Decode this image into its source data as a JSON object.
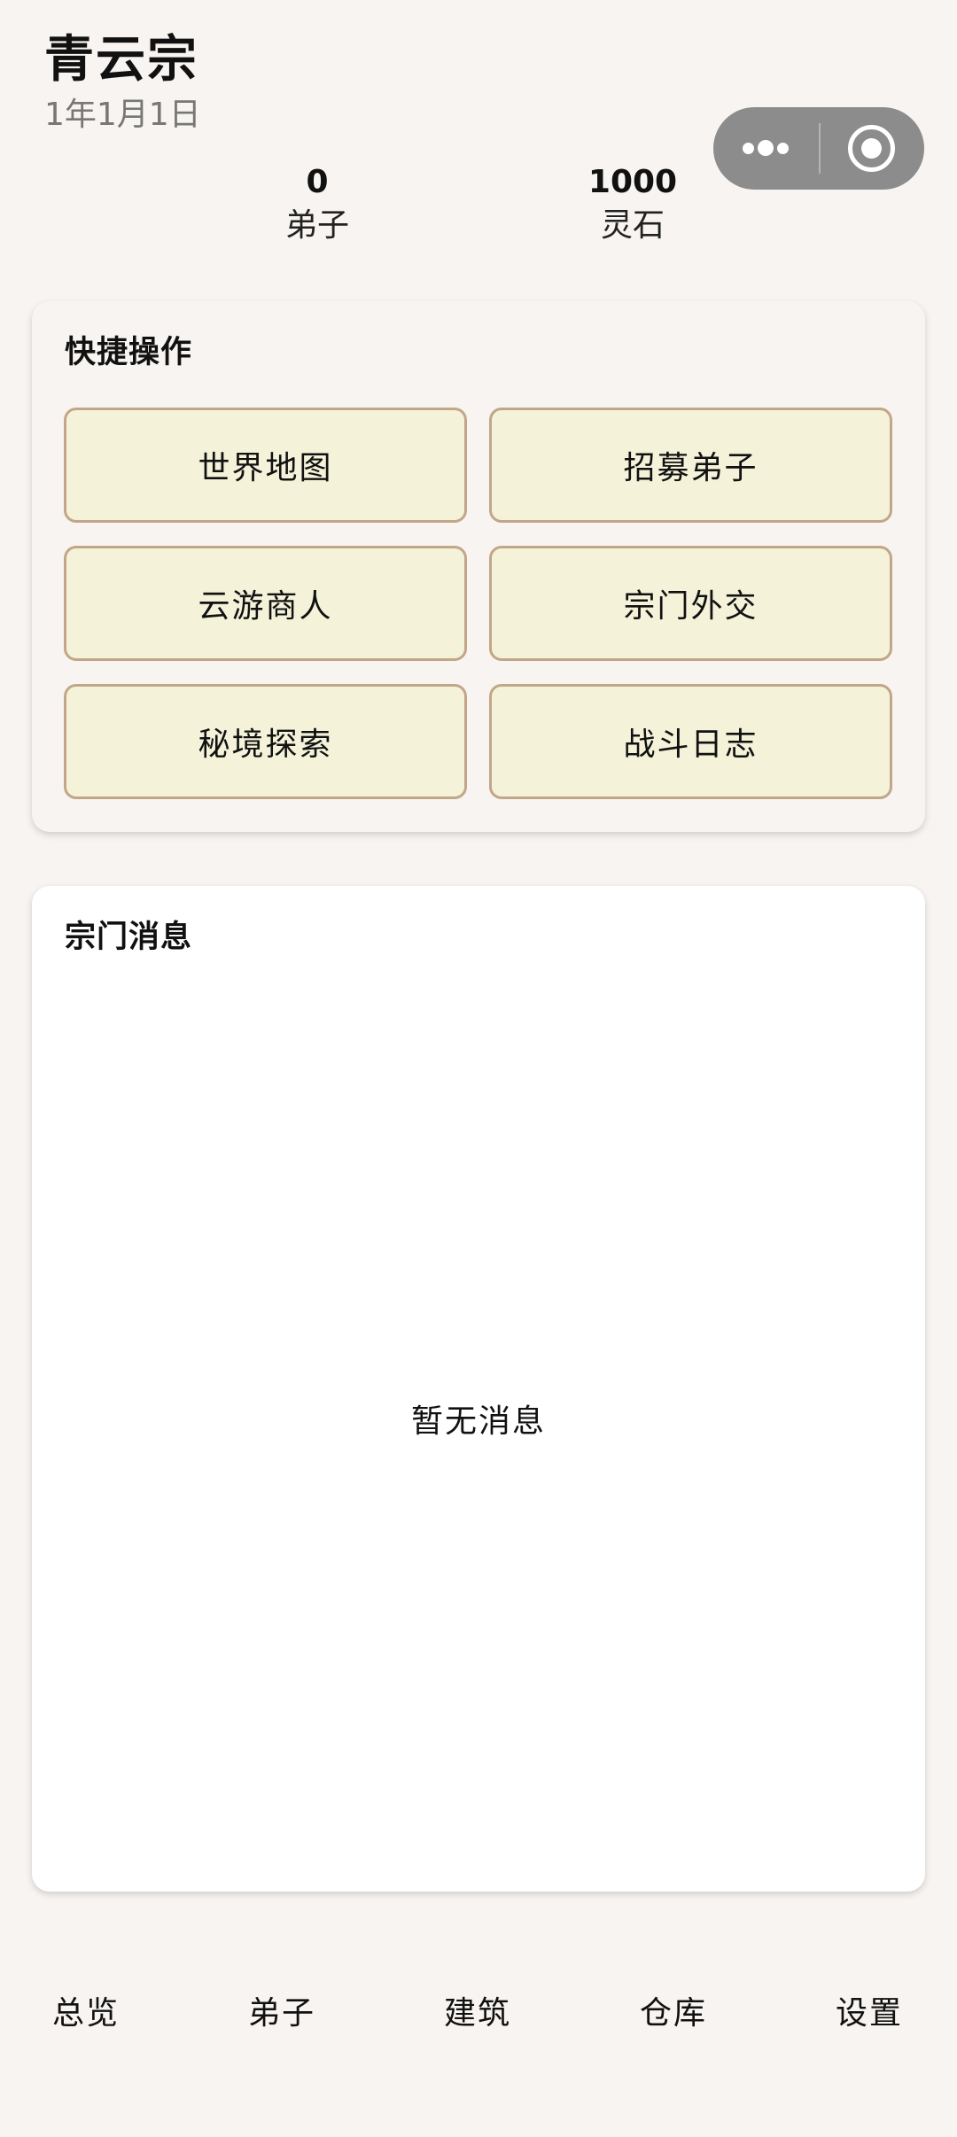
{
  "header": {
    "title": "青云宗",
    "date": "1年1月1日"
  },
  "stats": [
    {
      "value": "0",
      "label": "弟子"
    },
    {
      "value": "1000",
      "label": "灵石"
    }
  ],
  "quick_actions": {
    "title": "快捷操作",
    "buttons": [
      "世界地图",
      "招募弟子",
      "云游商人",
      "宗门外交",
      "秘境探索",
      "战斗日志"
    ]
  },
  "messages": {
    "title": "宗门消息",
    "empty_text": "暂无消息"
  },
  "tabbar": {
    "items": [
      "总览",
      "弟子",
      "建筑",
      "仓库",
      "设置"
    ]
  },
  "colors": {
    "background": "#f7f4f1",
    "button_fill": "#f4f3da",
    "button_border": "#c3a688",
    "capsule": "#8c8c8c"
  }
}
